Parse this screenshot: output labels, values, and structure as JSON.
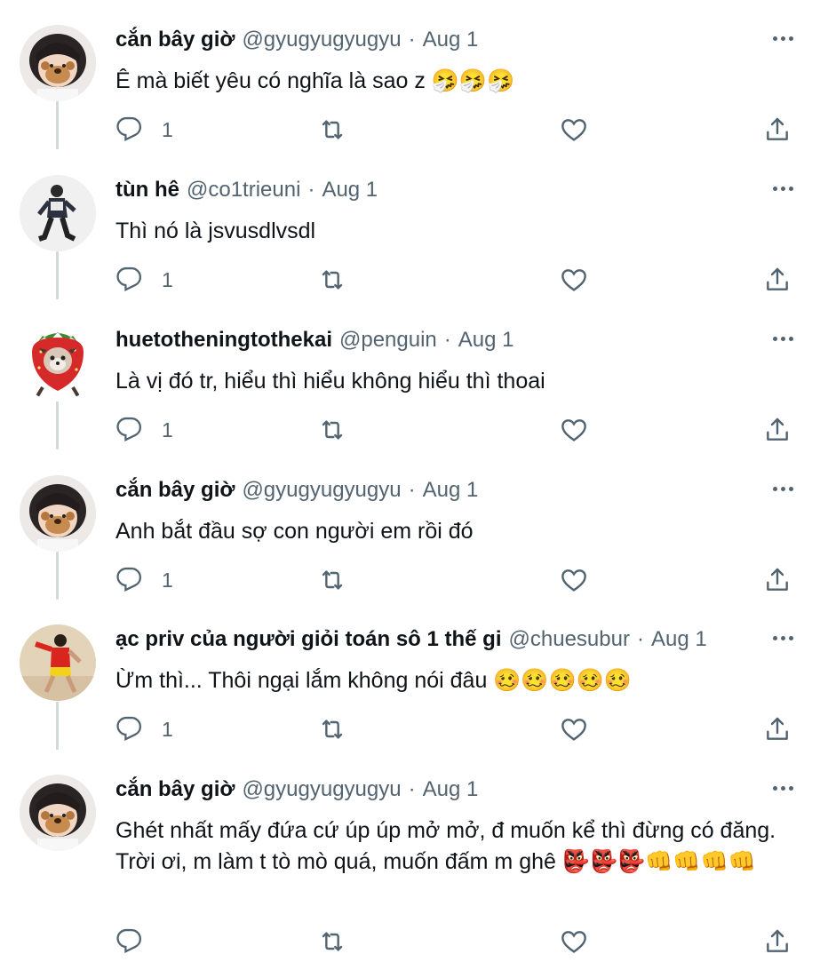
{
  "tweets": [
    {
      "name": "cắn bây giờ",
      "handle": "@gyugyugyugyu",
      "sep": "·",
      "date": "Aug 1",
      "text": "Ê mà biết yêu có nghĩa là sao z 🤧🤧🤧",
      "reply_count": "1",
      "avatar_icon": "girl-bear-filter-avatar"
    },
    {
      "name": "tùn hê",
      "handle": "@co1trieuni",
      "sep": "·",
      "date": "Aug 1",
      "text": "Thì nó là jsvusdlvsdl",
      "reply_count": "1",
      "avatar_icon": "dancing-boy-avatar"
    },
    {
      "name": "huetotheningtothekai",
      "handle": "@penguin",
      "sep": "·",
      "date": "Aug 1",
      "text": "Là vị đó tr, hiểu thì hiểu không hiểu thì thoai",
      "reply_count": "1",
      "avatar_icon": "strawberry-dog-avatar"
    },
    {
      "name": "cắn bây giờ",
      "handle": "@gyugyugyugyu",
      "sep": "·",
      "date": "Aug 1",
      "text": "Anh bắt đầu sợ con người em rồi đó",
      "reply_count": "1",
      "avatar_icon": "girl-bear-filter-avatar"
    },
    {
      "name": "ạc priv của người giỏi toán sô 1 thế gi",
      "handle": "@chuesubur",
      "sep": "·",
      "date": "Aug 1",
      "text": "Ừm thì... Thôi ngại lắm không nói đâu 🥴🥴🥴🥴🥴",
      "reply_count": "1",
      "avatar_icon": "red-shirt-dancer-avatar"
    },
    {
      "name": "cắn bây giờ",
      "handle": "@gyugyugyugyu",
      "sep": "·",
      "date": "Aug 1",
      "text": "Ghét nhất mấy đứa cứ úp úp mở mở, đ muốn kể thì đừng có đăng. Trời ơi, m làm t tò mò quá, muốn đấm m ghê 👺👺👺👊👊👊👊",
      "reply_count": "",
      "avatar_icon": "girl-bear-filter-avatar"
    }
  ],
  "icons": {
    "reply": "reply-icon",
    "retweet": "retweet-icon",
    "like": "heart-icon",
    "share": "share-icon",
    "more": "more-dots-icon"
  },
  "colors": {
    "text": "#0f1419",
    "muted": "#536471",
    "thread_line": "#cfd9de"
  }
}
